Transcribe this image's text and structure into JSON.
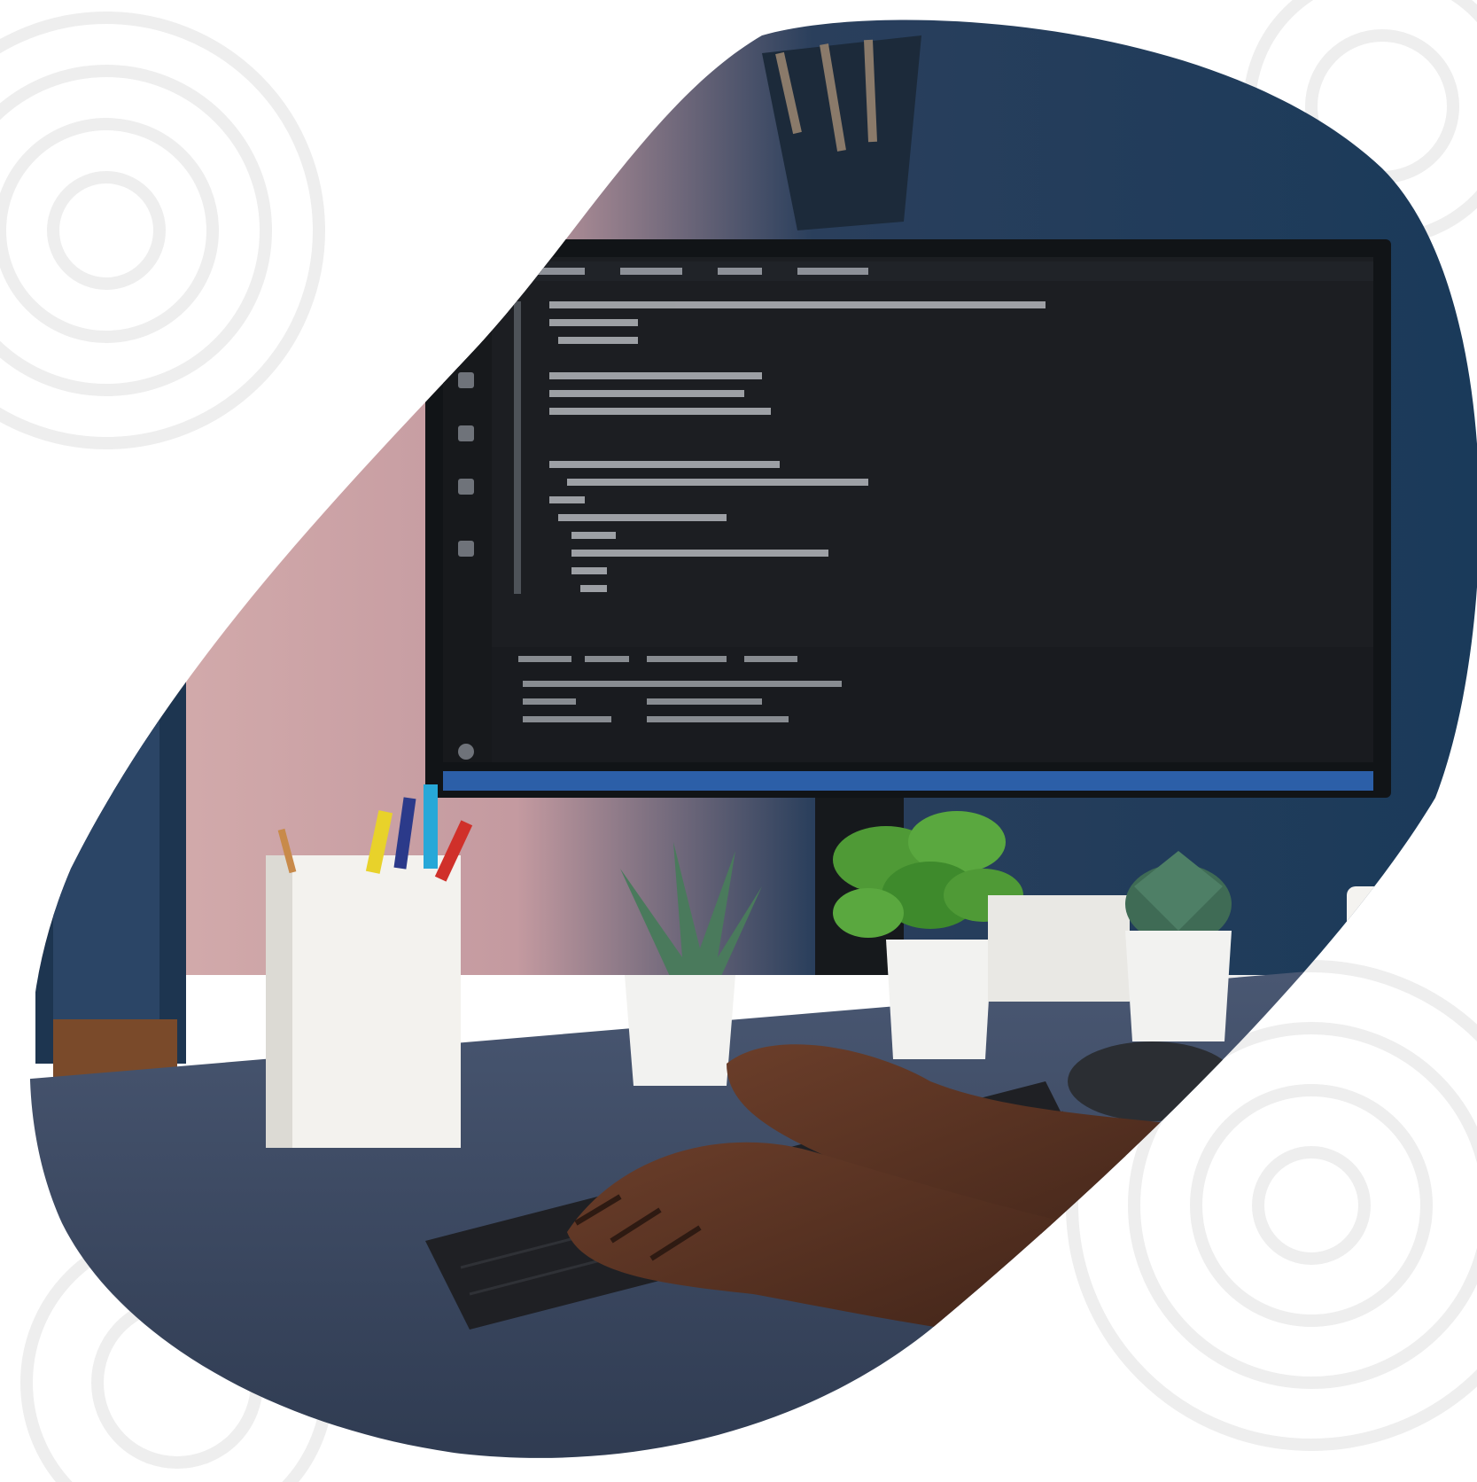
{
  "scene": {
    "description_icon": "desk-coding-photo",
    "colors": {
      "background": "#ffffff",
      "swirl_pattern": "#eeeeee",
      "wall_blue": "#1f3a55",
      "wall_dark": "#142434",
      "wall_pink": "#d9b2b0",
      "desk": "#3d4b63",
      "monitor_frame": "#111417",
      "screen": "#1c1e22",
      "code_text": "#c9ccd1",
      "status_bar": "#2c5fa8",
      "pot_white": "#f2f2f0",
      "plant_green": "#4f9a36",
      "succulent": "#3f6b55",
      "skin": "#5a3424",
      "keyboard": "#1f2024",
      "mouse": "#2b2e33"
    }
  }
}
